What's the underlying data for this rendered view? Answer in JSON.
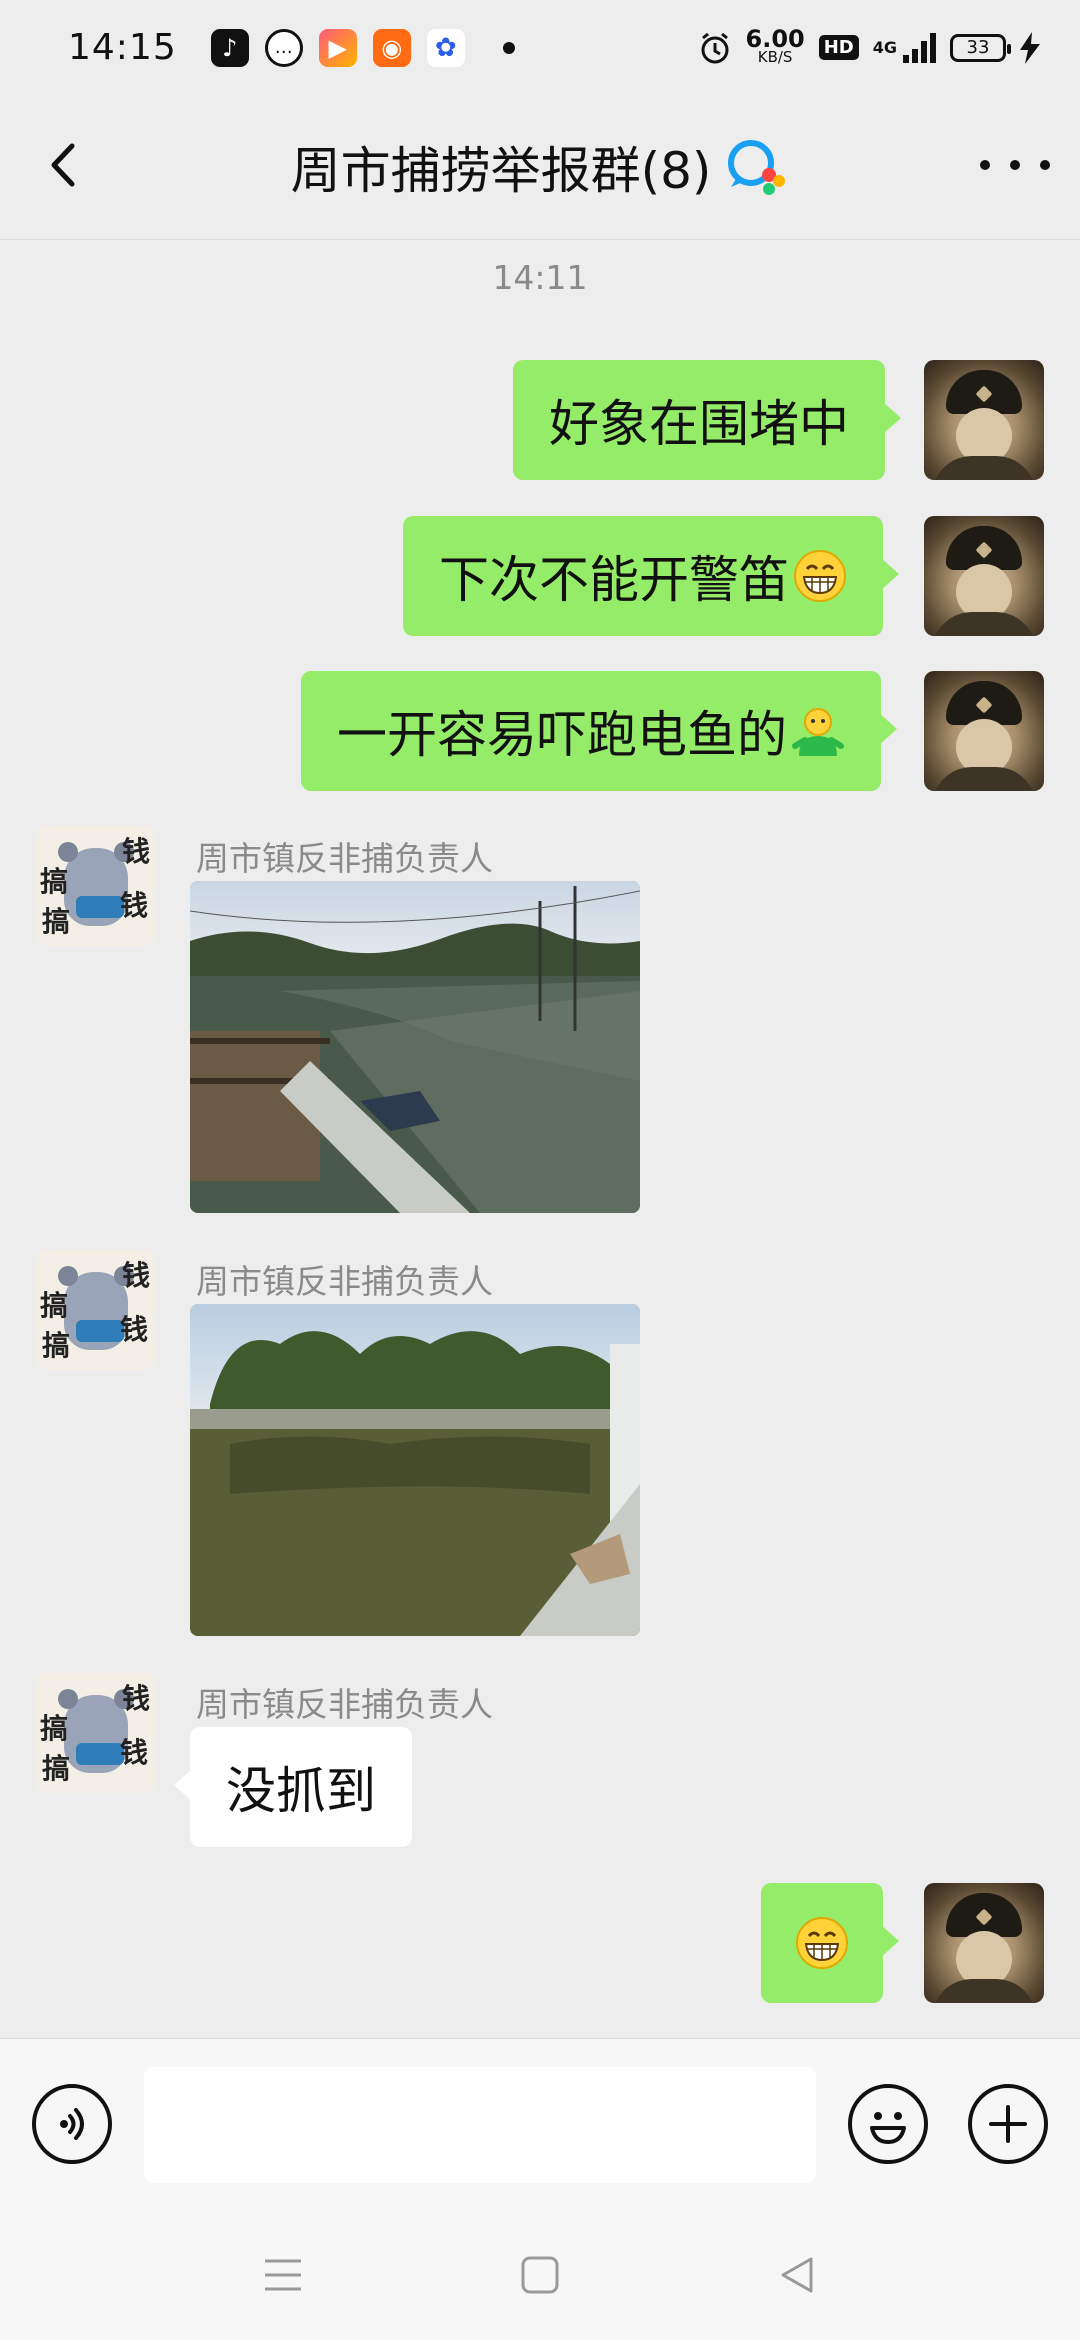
{
  "status_bar": {
    "time": "14:15",
    "network_speed_value": "6.00",
    "network_speed_unit": "KB/S",
    "hd_label": "HD",
    "network_type": "4G",
    "battery_level": "33",
    "app_icons": [
      "tiktok-icon",
      "chat-bubble-icon",
      "video-play-icon",
      "kuaishou-icon",
      "baidu-icon"
    ]
  },
  "header": {
    "title": "周市捕捞举报群(8)",
    "back_icon": "chevron-left-icon",
    "more_icon": "more-dots-icon",
    "badge_icon": "group-chat-badge-icon"
  },
  "chat": {
    "timestamp": "14:11",
    "messages": [
      {
        "side": "me",
        "text": "好象在围堵中"
      },
      {
        "side": "me",
        "text": "下次不能开警笛",
        "emoji": "grin-emoji-icon"
      },
      {
        "side": "me",
        "text": "一开容易吓跑电鱼的",
        "emoji": "green-figure-emoji-icon"
      },
      {
        "side": "other",
        "sender": "周市镇反非捕负责人",
        "type": "image",
        "image": "river-with-boat-photo-1"
      },
      {
        "side": "other",
        "sender": "周市镇反非捕负责人",
        "type": "image",
        "image": "river-with-boat-photo-2"
      },
      {
        "side": "other",
        "sender": "周市镇反非捕负责人",
        "text": "没抓到"
      },
      {
        "side": "me",
        "text": "",
        "emoji": "grin-emoji-icon"
      }
    ],
    "other_avatar_chars": [
      "钱",
      "搞",
      "搞",
      "钱"
    ]
  },
  "input_bar": {
    "voice_icon": "voice-input-icon",
    "message_placeholder": "",
    "emoji_icon": "smiley-face-icon",
    "plus_icon": "plus-icon"
  },
  "nav_bar": {
    "menu_icon": "menu-lines-icon",
    "home_icon": "home-square-icon",
    "back_icon": "back-triangle-icon"
  },
  "colors": {
    "my_bubble": "#95ec69",
    "other_bubble": "#ffffff",
    "background": "#ededed"
  }
}
